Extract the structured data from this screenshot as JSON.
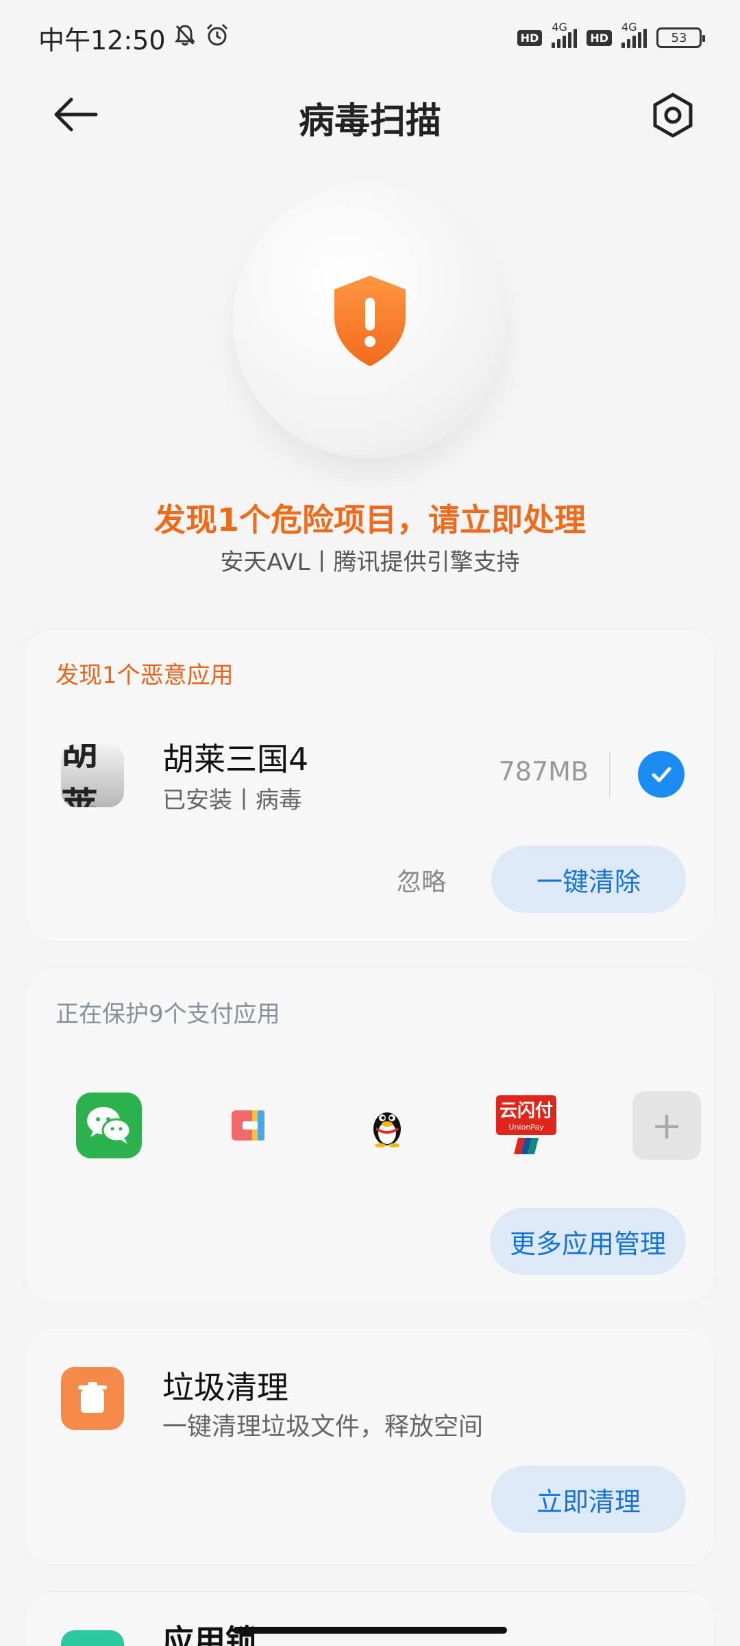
{
  "status_bar": {
    "time": "中午12:50",
    "hd1": "HD",
    "net1": "4G",
    "hd2": "HD",
    "net2": "4G",
    "battery": "53"
  },
  "header": {
    "title": "病毒扫描"
  },
  "hero": {
    "headline": "发现1个危险项目，请立即处理",
    "engine": "安天AVL丨腾讯提供引擎支持"
  },
  "malware_card": {
    "heading": "发现1个恶意应用",
    "app_icon_text": "胡莱",
    "app_name": "胡莱三国4",
    "app_meta": "已安装丨病毒",
    "app_size": "787MB",
    "ignore_label": "忽略",
    "clean_label": "一键清除"
  },
  "payment_card": {
    "heading": "正在保护9个支付应用",
    "apps": [
      "wechat",
      "wallet",
      "qq",
      "unionpay"
    ],
    "unionpay_text": "云闪付",
    "unionpay_sub": "UnionPay",
    "add_label": "+",
    "more_label": "更多应用管理"
  },
  "junk_card": {
    "title": "垃圾清理",
    "subtitle": "一键清理垃圾文件，释放空间",
    "button_label": "立即清理"
  },
  "lock_card": {
    "title": "应用锁"
  },
  "colors": {
    "warning": "#f06a1a",
    "accent_blue": "#1a8cf2",
    "wechat_green": "#2bb24c",
    "trash_orange": "#f68a4b"
  }
}
